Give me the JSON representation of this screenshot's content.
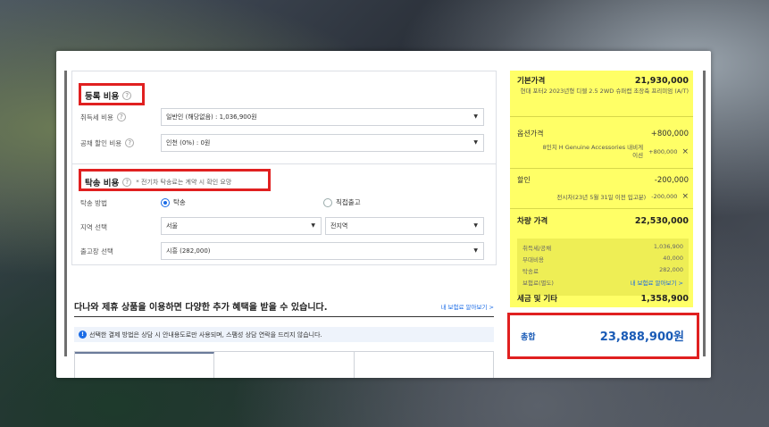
{
  "registration": {
    "title": "등록 비용",
    "help": "?",
    "acquisition_tax_label": "취득세 비용",
    "acquisition_tax_value": "일반인 (해당없음) : 1,036,900원",
    "bond_discount_label": "공채 할인 비용",
    "bond_discount_value": "인천 (0%) : 0원"
  },
  "delivery": {
    "title": "탁송 비용",
    "help": "?",
    "note": "* 전기차 탁송료는 계약 시 확인 요망",
    "method_label": "탁송 방법",
    "option_delivery": "탁송",
    "option_pickup": "직접출고",
    "region_label": "지역 선택",
    "region_value": "서울",
    "district_value": "전지역",
    "factory_label": "출고장 선택",
    "factory_value": "시흥 (282,000)"
  },
  "promo": {
    "text": "다나와 제휴 상품을 이용하면 다양한 추가 혜택을 받을 수 있습니다.",
    "link": "내 보험료 알아보기 >"
  },
  "info_bar": {
    "icon": "!",
    "text": "선택한 결제 방법은 상담 시 안내용도로만 사용되며, 스팸성 상담 연락을 드리지 않습니다."
  },
  "summary": {
    "base_price_label": "기본가격",
    "base_price_value": "21,930,000",
    "base_price_desc": "현대 포터2 2023년형 디젤 2.5 2WD 슈퍼캡 초장축 프리미엄 (A/T)",
    "option_label": "옵션가격",
    "option_value": "+800,000",
    "option_item_name": "8인치 H Genuine Accessories 내비게이션",
    "option_item_value": "+800,000",
    "discount_label": "할인",
    "discount_value": "-200,000",
    "discount_item_name": "전시차(23년 5월 31일 이전 입고분)",
    "discount_item_value": "-200,000",
    "vehicle_price_label": "차량 가격",
    "vehicle_price_value": "22,530,000",
    "fees": [
      {
        "label": "취득세/공채",
        "value": "1,036,900"
      },
      {
        "label": "부대비용",
        "value": "40,000"
      },
      {
        "label": "탁송료",
        "value": "282,000"
      },
      {
        "label": "보험료(별도)",
        "value": "내 보험료 알아보기 >"
      }
    ],
    "tax_label": "세금 및 기타",
    "tax_value": "1,358,900",
    "remove_icon": "×"
  },
  "total": {
    "label": "총합",
    "value": "23,888,900원"
  },
  "colors": {
    "highlight_red": "#e02020",
    "summary_yellow": "#ffff66",
    "accent_blue": "#1a6be6"
  }
}
